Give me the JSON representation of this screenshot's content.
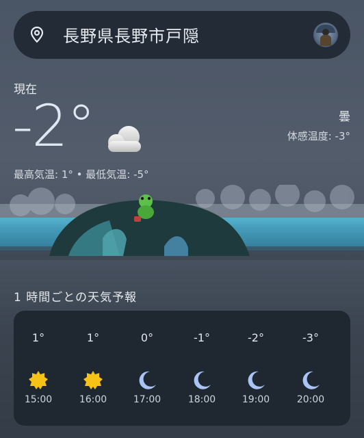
{
  "search": {
    "location": "長野県長野市戸隠"
  },
  "current": {
    "label": "現在",
    "temperature": "-2°",
    "condition": "曇",
    "feels_like": "体感温度: -3°",
    "hi_lo": "最高気温: 1° • 最低気温: -5°",
    "icon": "cloud-icon"
  },
  "hourly": {
    "title": "1 時間ごとの天気予報",
    "items": [
      {
        "temp": "1°",
        "time": "15:00",
        "icon": "sun-icon"
      },
      {
        "temp": "1°",
        "time": "16:00",
        "icon": "sun-icon"
      },
      {
        "temp": "0°",
        "time": "17:00",
        "icon": "moon-icon"
      },
      {
        "temp": "-1°",
        "time": "18:00",
        "icon": "moon-icon"
      },
      {
        "temp": "-2°",
        "time": "19:00",
        "icon": "moon-icon"
      },
      {
        "temp": "-3°",
        "time": "20:00",
        "icon": "moon-icon"
      }
    ]
  },
  "colors": {
    "sun": "#f6c21a",
    "moon": "#a9c4f5",
    "card": "#1f2731",
    "searchbar": "#222b36"
  }
}
